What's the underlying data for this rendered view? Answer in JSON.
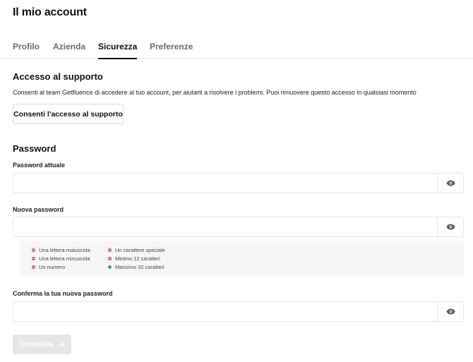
{
  "page": {
    "title": "Il mio account"
  },
  "tabs": [
    {
      "label": "Profilo",
      "active": false
    },
    {
      "label": "Azienda",
      "active": false
    },
    {
      "label": "Sicurezza",
      "active": true
    },
    {
      "label": "Preferenze",
      "active": false
    }
  ],
  "support": {
    "title": "Accesso al supporto",
    "description": "Consenti al team Getfluence di accedere al tuo account, per aiutarti a risolvere i problemi. Puoi rimuovere questo accesso in qualsiasi momento",
    "button_label": "Consenti l'accesso al supporto"
  },
  "password": {
    "title": "Password",
    "current": {
      "label": "Password attuale",
      "value": "",
      "placeholder": ""
    },
    "new": {
      "label": "Nuova password",
      "value": "",
      "placeholder": ""
    },
    "confirm": {
      "label": "Conferma la tua nuova password",
      "value": "",
      "placeholder": ""
    },
    "rules": [
      {
        "text": "Una lettera maiuscola",
        "status": "unmet"
      },
      {
        "text": "Una lettera minuscola",
        "status": "unmet"
      },
      {
        "text": "Un numero",
        "status": "unmet"
      },
      {
        "text": "Un carattere speciale",
        "status": "unmet"
      },
      {
        "text": "Minimo 12 caratteri",
        "status": "unmet"
      },
      {
        "text": "Massimo 32 caratteri",
        "status": "met"
      }
    ],
    "submit_label": "Convalida",
    "submit_disabled": true
  },
  "icons": {
    "eye": "eye-icon",
    "arrow": "arrow-right-icon"
  },
  "colors": {
    "rule_unmet": "#d64545",
    "rule_met": "#3aa656",
    "submit_disabled_bg": "#e6e6e6"
  }
}
